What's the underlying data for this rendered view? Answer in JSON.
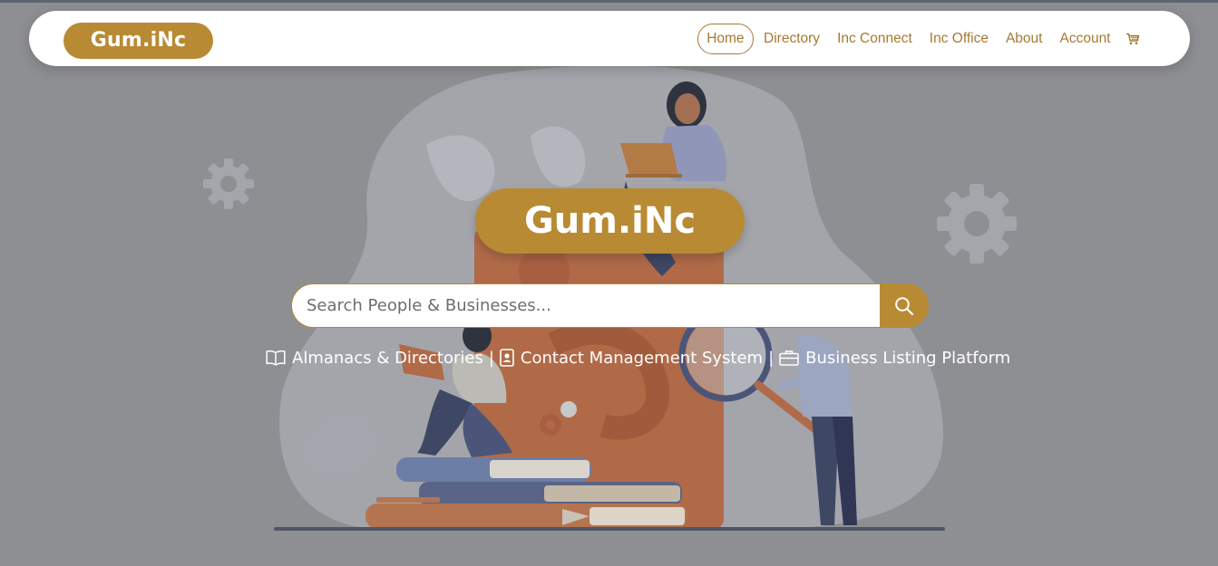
{
  "brand": {
    "logo_text": "Gum.iNc",
    "hero_text": "Gum.iNc"
  },
  "nav": {
    "items": [
      {
        "label": "Home",
        "active": true
      },
      {
        "label": "Directory",
        "active": false
      },
      {
        "label": "Inc Connect",
        "active": false
      },
      {
        "label": "Inc Office",
        "active": false
      },
      {
        "label": "About",
        "active": false
      },
      {
        "label": "Account",
        "active": false
      }
    ],
    "cart_icon": "shopping-cart-icon"
  },
  "search": {
    "placeholder": "Search People & Businesses...",
    "value": "",
    "button_icon": "search-icon"
  },
  "features": {
    "items": [
      {
        "label": "Almanacs & Directories",
        "icon": "open-book-icon"
      },
      {
        "label": "Contact Management System",
        "icon": "contact-card-icon"
      },
      {
        "label": "Business Listing Platform",
        "icon": "briefcase-icon"
      }
    ],
    "separator": "|"
  },
  "colors": {
    "accent": "#b88a33",
    "nav_text": "#a57a32",
    "overlay": "#8e8f92",
    "white": "#ffffff"
  }
}
